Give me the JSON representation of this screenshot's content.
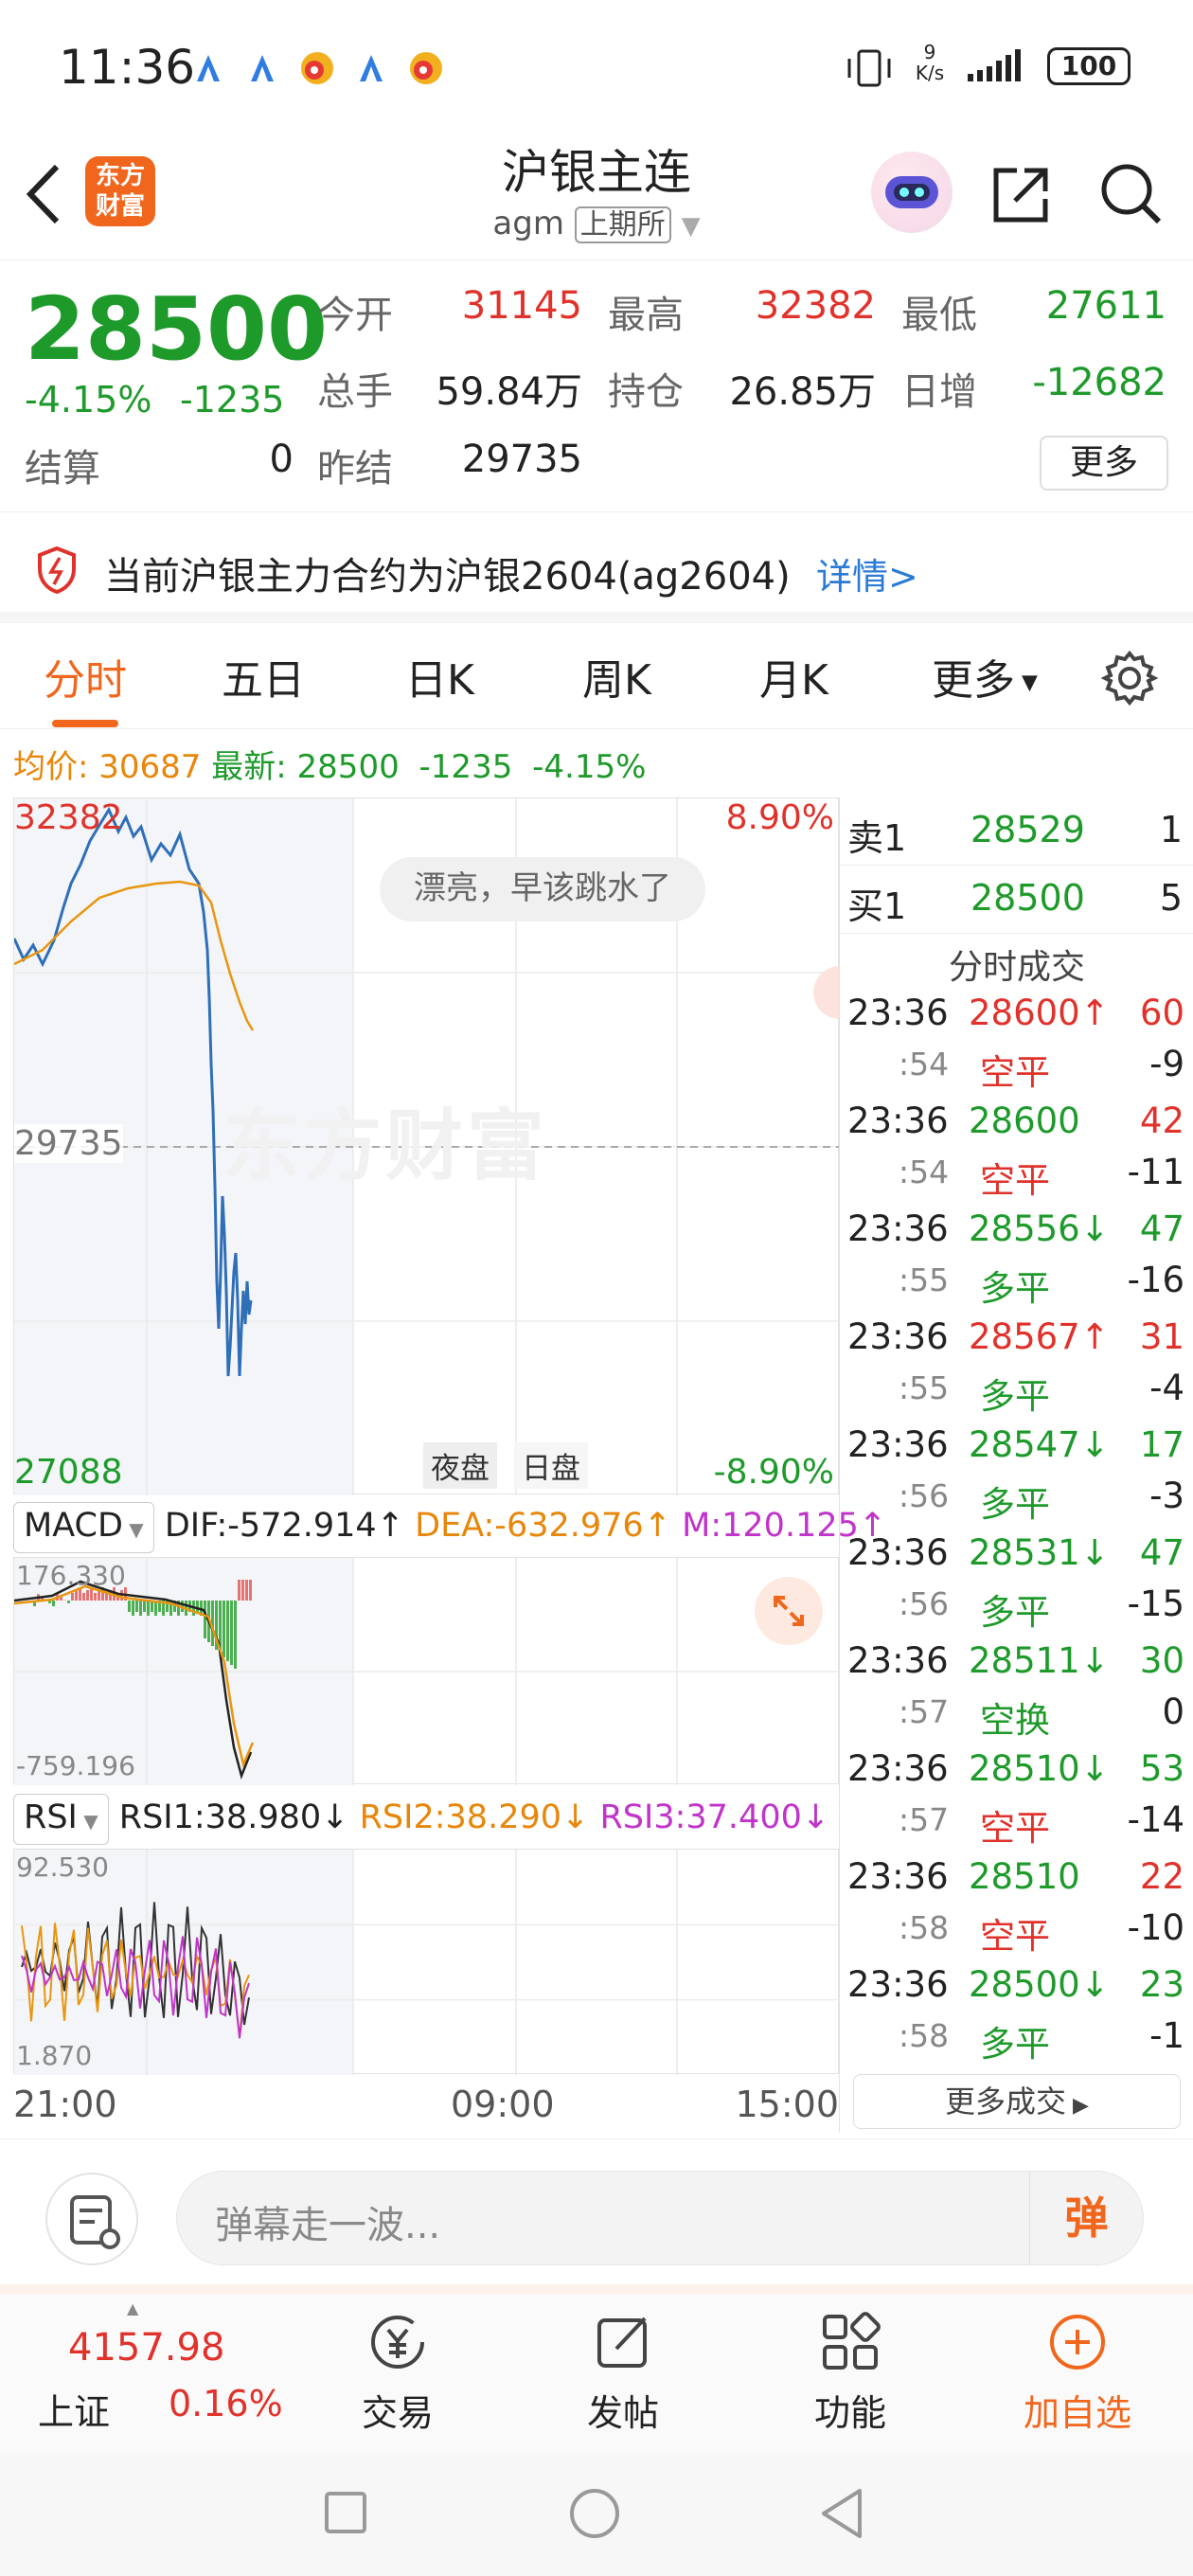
{
  "status_bar": {
    "time": "11:36",
    "net_speed_top": "9",
    "net_speed_unit": "K/s",
    "battery": "100"
  },
  "header": {
    "title": "沪银主连",
    "code": "agm",
    "exchange": "上期所",
    "logo_line1": "东方",
    "logo_line2": "财富"
  },
  "quote": {
    "price": "28500",
    "change_pct": "-4.15%",
    "change": "-1235",
    "open_label": "今开",
    "open": "31145",
    "high_label": "最高",
    "high": "32382",
    "low_label": "最低",
    "low": "27611",
    "vol_label": "总手",
    "vol": "59.84万",
    "oi_label": "持仓",
    "oi": "26.85万",
    "daily_inc_label": "日增",
    "daily_inc": "-12682",
    "settle_label": "结算",
    "settle": "0",
    "prev_settle_label": "昨结",
    "prev_settle": "29735",
    "more": "更多"
  },
  "notice": {
    "text": "当前沪银主力合约为沪银2604(ag2604)",
    "link": "详情>"
  },
  "tabs": [
    "分时",
    "五日",
    "日K",
    "周K",
    "月K",
    "更多"
  ],
  "summary": {
    "avg_label": "均价:",
    "avg": "30687",
    "latest_label": "最新:",
    "latest": "28500",
    "change": "-1235",
    "pct": "-4.15%"
  },
  "chart_labels": {
    "top": "32382",
    "top_pct": "8.90%",
    "mid": "29735",
    "bottom": "27088",
    "bottom_pct": "-8.90%",
    "night": "夜盘",
    "day": "日盘",
    "bubble": "漂亮，早该跳水了",
    "watermark": "东方财富",
    "t0": "21:00",
    "t1": "09:00",
    "t2": "15:00"
  },
  "macd": {
    "label": "MACD",
    "dif": "DIF:-572.914",
    "dea": "DEA:-632.976",
    "m": "M:120.125",
    "top": "176.330",
    "bottom": "-759.196"
  },
  "rsi": {
    "label": "RSI",
    "rsi1": "RSI1:38.980",
    "rsi2": "RSI2:38.290",
    "rsi3": "RSI3:37.400",
    "top": "92.530",
    "bottom": "1.870"
  },
  "orderbook": {
    "sell_label": "卖1",
    "sell_price": "28529",
    "sell_vol": "1",
    "buy_label": "买1",
    "buy_price": "28500",
    "buy_vol": "5",
    "trades_title": "分时成交",
    "more_trades": "更多成交"
  },
  "trades": [
    {
      "time": "23:36",
      "price": "28600",
      "dir": "up",
      "vol": "60",
      "sec": ":54",
      "type": "空平",
      "type_color": "red",
      "chg": "-9"
    },
    {
      "time": "23:36",
      "price": "28600",
      "dir": "",
      "vol": "42",
      "sec": ":54",
      "type": "空平",
      "type_color": "red",
      "chg": "-11"
    },
    {
      "time": "23:36",
      "price": "28556",
      "dir": "down",
      "vol": "47",
      "sec": ":55",
      "type": "多平",
      "type_color": "green",
      "chg": "-16"
    },
    {
      "time": "23:36",
      "price": "28567",
      "dir": "up",
      "vol": "31",
      "sec": ":55",
      "type": "多平",
      "type_color": "green",
      "chg": "-4"
    },
    {
      "time": "23:36",
      "price": "28547",
      "dir": "down",
      "vol": "17",
      "sec": ":56",
      "type": "多平",
      "type_color": "green",
      "chg": "-3"
    },
    {
      "time": "23:36",
      "price": "28531",
      "dir": "down",
      "vol": "47",
      "sec": ":56",
      "type": "多平",
      "type_color": "green",
      "chg": "-15"
    },
    {
      "time": "23:36",
      "price": "28511",
      "dir": "down",
      "vol": "30",
      "sec": ":57",
      "type": "空换",
      "type_color": "green",
      "chg": "0"
    },
    {
      "time": "23:36",
      "price": "28510",
      "dir": "down",
      "vol": "53",
      "sec": ":57",
      "type": "空平",
      "type_color": "red",
      "chg": "-14"
    },
    {
      "time": "23:36",
      "price": "28510",
      "dir": "",
      "vol": "22",
      "sec": ":58",
      "type": "空平",
      "type_color": "red",
      "chg": "-10"
    },
    {
      "time": "23:36",
      "price": "28500",
      "dir": "down",
      "vol": "23",
      "sec": ":58",
      "type": "多平",
      "type_color": "green",
      "chg": "-1"
    }
  ],
  "comment": {
    "placeholder": "弹幕走一波...",
    "danmu": "弹"
  },
  "bottom_nav": {
    "index_value": "4157.98",
    "index_name": "上证",
    "index_pct": "0.16%",
    "trade": "交易",
    "post": "发帖",
    "func": "功能",
    "add": "加自选"
  },
  "colors": {
    "up": "#e0322b",
    "down": "#1e9a2b",
    "accent": "#f0661c",
    "price_line": "#2f6fb8",
    "avg_line": "#e8960f"
  }
}
